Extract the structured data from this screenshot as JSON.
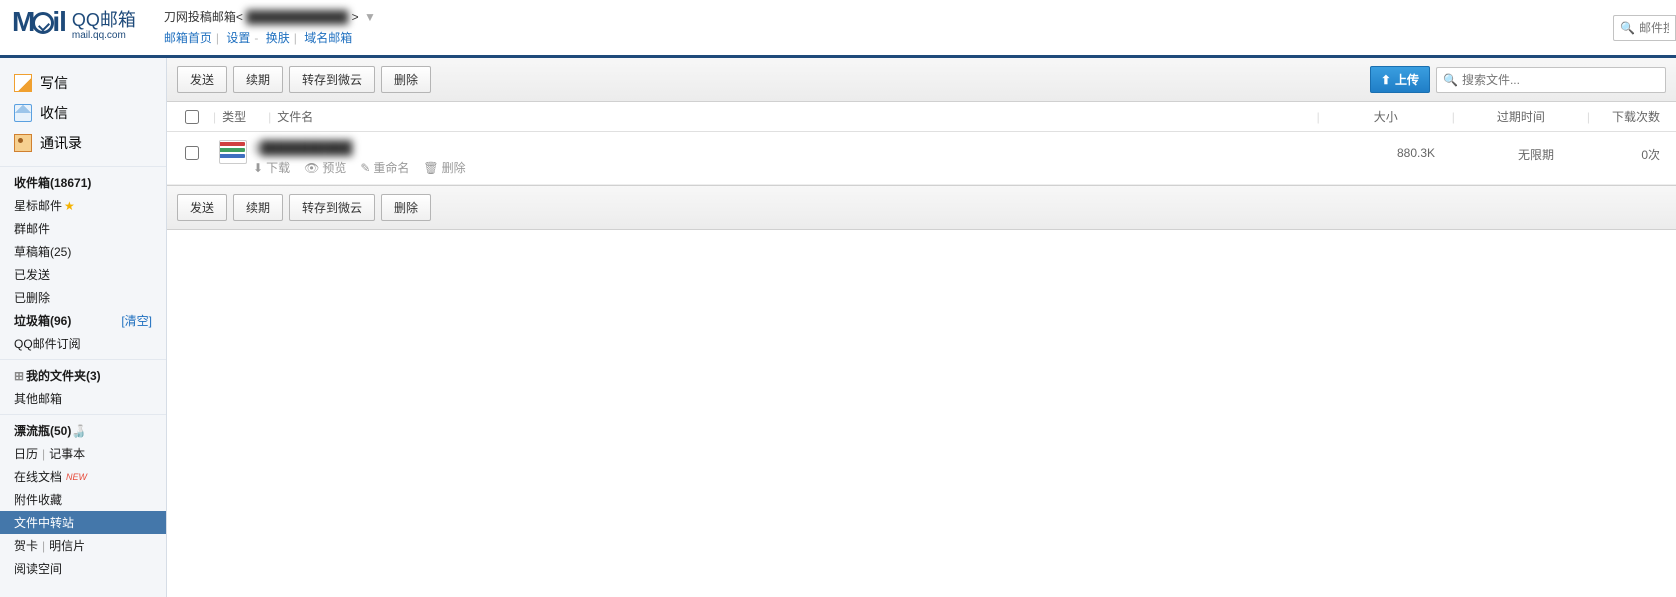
{
  "header": {
    "logo_cn": "QQ邮箱",
    "logo_en": "mail.qq.com",
    "account_prefix": "刀网投稿邮箱<",
    "account_suffix": ">",
    "caret": "▼",
    "nav": {
      "home": "邮箱首页",
      "settings": "设置",
      "skin": "换肤",
      "domain": "域名邮箱"
    },
    "top_search_placeholder": "邮件搜"
  },
  "sidebar": {
    "primary": {
      "compose": "写信",
      "receive": "收信",
      "contacts": "通讯录"
    },
    "inbox_label": "收件箱(18671)",
    "starred": "星标邮件",
    "group": "群邮件",
    "drafts": "草稿箱(25)",
    "sent": "已发送",
    "deleted": "已删除",
    "trash_label": "垃圾箱(96)",
    "trash_clear": "[清空]",
    "subscribe": "QQ邮件订阅",
    "myfolders_label": "我的文件夹(3)",
    "other_mail": "其他邮箱",
    "drift_label": "漂流瓶(50)",
    "calendar": "日历",
    "notes": "记事本",
    "onlinedoc": "在线文档",
    "new_badge": "NEW",
    "attach_fav": "附件收藏",
    "file_station": "文件中转站",
    "cards": "贺卡",
    "postcards": "明信片",
    "readspace": "阅读空间"
  },
  "toolbar": {
    "send": "发送",
    "renew": "续期",
    "to_weiyun": "转存到微云",
    "delete": "删除",
    "upload": "上传",
    "search_placeholder": "搜索文件..."
  },
  "thead": {
    "type": "类型",
    "name": "文件名",
    "size": "大小",
    "expire": "过期时间",
    "dlcount": "下载次数"
  },
  "file": {
    "name_masked": "1██████████",
    "size": "880.3K",
    "expire": "无限期",
    "dlcount": "0次",
    "ops": {
      "download": "下载",
      "preview": "预览",
      "rename": "重命名",
      "delete": "删除"
    }
  }
}
